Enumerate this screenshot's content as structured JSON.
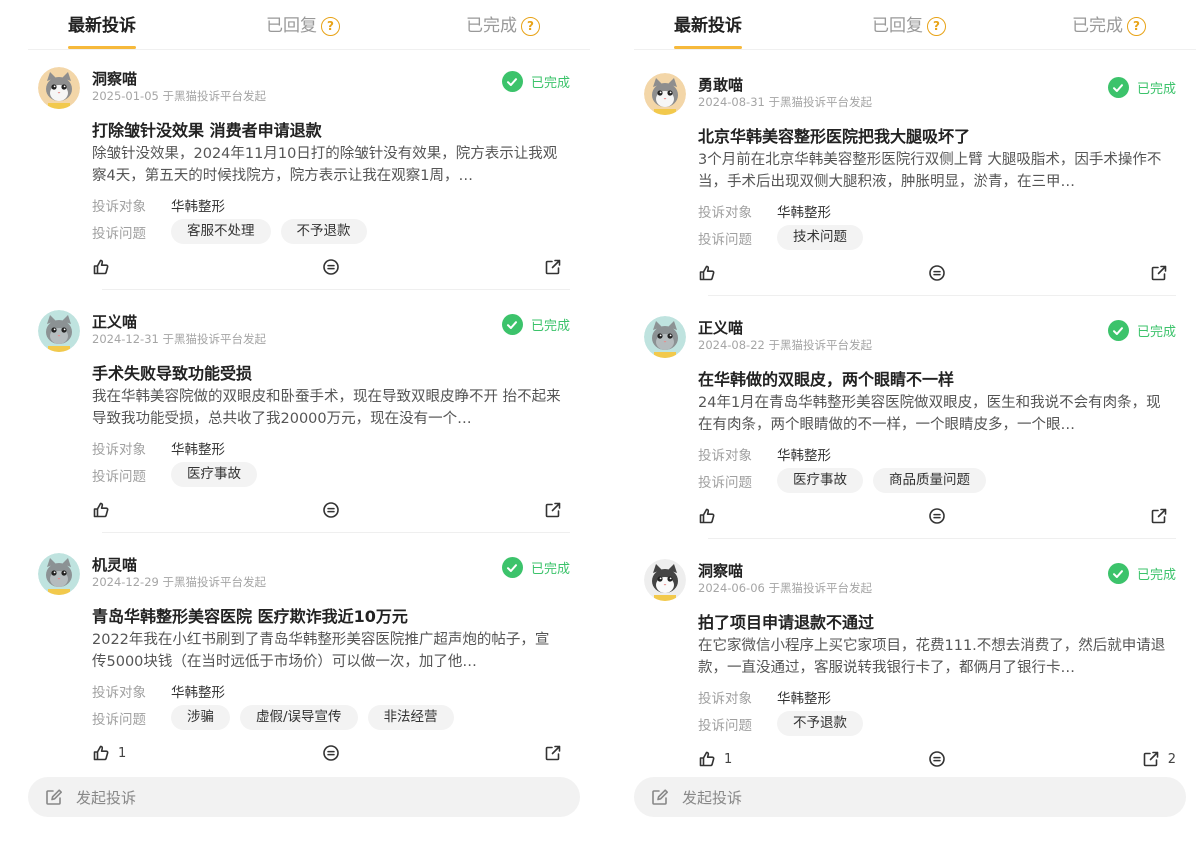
{
  "panels": [
    {
      "tabs": [
        {
          "label": "最新投诉",
          "active": true,
          "help": false
        },
        {
          "label": "已回复",
          "active": false,
          "help": true
        },
        {
          "label": "已完成",
          "active": false,
          "help": true
        }
      ],
      "cards": [
        {
          "avatar": "cat-avatar-orange",
          "user": "洞察喵",
          "meta": "2025-01-05 于黑猫投诉平台发起",
          "status": "已完成",
          "title": "打除皱针没效果 消费者申请退款",
          "desc": "除皱针没效果，2024年11月10日打的除皱针没有效果，院方表示让我观察4天，第五天的时候找院方，院方表示让我在观察1周，…",
          "target_label": "投诉对象",
          "target": "华韩整形",
          "issue_label": "投诉问题",
          "tags": [
            "客服不处理",
            "不予退款"
          ],
          "likes": "",
          "shares": ""
        },
        {
          "avatar": "cat-avatar-teal",
          "user": "正义喵",
          "meta": "2024-12-31 于黑猫投诉平台发起",
          "status": "已完成",
          "title": "手术失败导致功能受损",
          "desc": "我在华韩美容院做的双眼皮和卧蚕手术，现在导致双眼皮睁不开 抬不起来导致我功能受损，总共收了我20000万元，现在没有一个…",
          "target_label": "投诉对象",
          "target": "华韩整形",
          "issue_label": "投诉问题",
          "tags": [
            "医疗事故"
          ],
          "likes": "",
          "shares": ""
        },
        {
          "avatar": "cat-avatar-teal",
          "user": "机灵喵",
          "meta": "2024-12-29 于黑猫投诉平台发起",
          "status": "已完成",
          "title": "青岛华韩整形美容医院 医疗欺诈我近10万元",
          "desc": "2022年我在小红书刷到了青岛华韩整形美容医院推广超声炮的帖子，宣传5000块钱（在当时远低于市场价）可以做一次，加了他…",
          "target_label": "投诉对象",
          "target": "华韩整形",
          "issue_label": "投诉问题",
          "tags": [
            "涉骗",
            "虚假/误导宣传",
            "非法经营"
          ],
          "likes": "1",
          "shares": ""
        }
      ],
      "compose": "发起投诉"
    },
    {
      "tabs": [
        {
          "label": "最新投诉",
          "active": true,
          "help": false
        },
        {
          "label": "已回复",
          "active": false,
          "help": true
        },
        {
          "label": "已完成",
          "active": false,
          "help": true
        }
      ],
      "cards": [
        {
          "avatar": "cat-avatar-orange",
          "user": "勇敢喵",
          "meta": "2024-08-31 于黑猫投诉平台发起",
          "status": "已完成",
          "title": "北京华韩美容整形医院把我大腿吸坏了",
          "desc": "3个月前在北京华韩美容整形医院行双侧上臂 大腿吸脂术，因手术操作不当，手术后出现双侧大腿积液，肿胀明显，淤青，在三甲…",
          "target_label": "投诉对象",
          "target": "华韩整形",
          "issue_label": "投诉问题",
          "tags": [
            "技术问题"
          ],
          "likes": "",
          "shares": ""
        },
        {
          "avatar": "cat-avatar-teal",
          "user": "正义喵",
          "meta": "2024-08-22 于黑猫投诉平台发起",
          "status": "已完成",
          "title": "在华韩做的双眼皮，两个眼睛不一样",
          "desc": "24年1月在青岛华韩整形美容医院做双眼皮，医生和我说不会有肉条，现在有肉条，两个眼睛做的不一样，一个眼睛皮多，一个眼…",
          "target_label": "投诉对象",
          "target": "华韩整形",
          "issue_label": "投诉问题",
          "tags": [
            "医疗事故",
            "商品质量问题"
          ],
          "likes": "",
          "shares": ""
        },
        {
          "avatar": "cat-avatar-white",
          "user": "洞察喵",
          "meta": "2024-06-06 于黑猫投诉平台发起",
          "status": "已完成",
          "title": "拍了项目申请退款不通过",
          "desc": "在它家微信小程序上买它家项目，花费111.不想去消费了，然后就申请退款，一直没通过，客服说转我银行卡了，都俩月了银行卡…",
          "target_label": "投诉对象",
          "target": "华韩整形",
          "issue_label": "投诉问题",
          "tags": [
            "不予退款"
          ],
          "likes": "1",
          "shares": "2"
        }
      ],
      "compose": "发起投诉"
    }
  ],
  "icons": {
    "status": "check-circle-icon",
    "help": "question-circle-icon",
    "like": "thumbs-up-icon",
    "comment": "comment-icon",
    "share": "share-icon",
    "compose": "edit-icon"
  },
  "colors": {
    "accent": "#f6b93b",
    "help": "#e8a317",
    "success": "#3cc36b",
    "muted": "#a0a0a0",
    "tag_bg": "#f3f3f3"
  }
}
